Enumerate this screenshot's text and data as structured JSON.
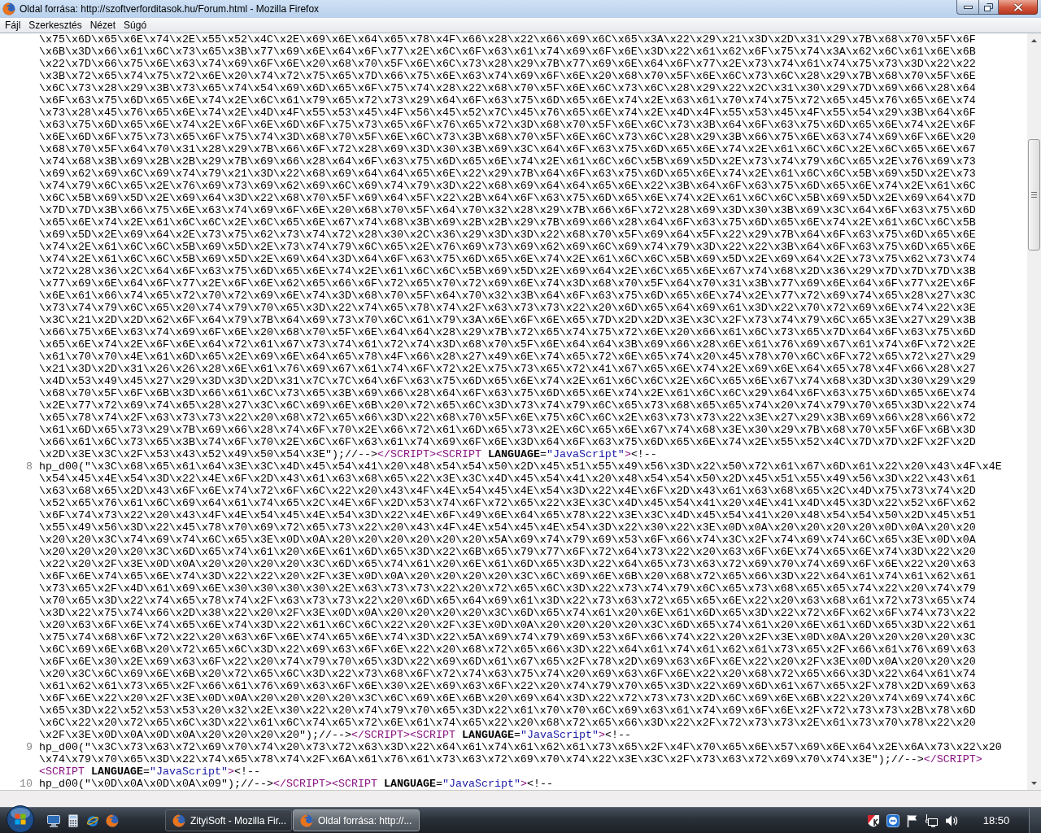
{
  "window": {
    "title": "Oldal forrása: http://szoftverforditasok.hu/Forum.html - Mozilla Firefox"
  },
  "menu": [
    "Fájl",
    "Szerkesztés",
    "Nézet",
    "Súgó"
  ],
  "source_view": {
    "lines": [
      {
        "rows": [
          [
            {
              "kind": "text",
              "text": "\\x75\\x6D\\x65\\x6E\\x74\\x2E\\x55\\x52\\x4C\\x2E\\x69\\x6E\\x64\\x65\\x78\\x4F\\x66\\x28\\x22\\x66\\x69\\x6C\\x65\\x3A\\x22\\x29\\x21\\x3D\\x2D\\x31\\x29\\x7B\\x68\\x70\\x5F\\x6F"
            }
          ],
          [
            {
              "kind": "text",
              "text": "\\x6B\\x3D\\x66\\x61\\x6C\\x73\\x65\\x3B\\x77\\x69\\x6E\\x64\\x6F\\x77\\x2E\\x6C\\x6F\\x63\\x61\\x74\\x69\\x6F\\x6E\\x3D\\x22\\x61\\x62\\x6F\\x75\\x74\\x3A\\x62\\x6C\\x61\\x6E\\x6B"
            }
          ],
          [
            {
              "kind": "text",
              "text": "\\x22\\x7D\\x66\\x75\\x6E\\x63\\x74\\x69\\x6F\\x6E\\x20\\x68\\x70\\x5F\\x6E\\x6C\\x73\\x28\\x29\\x7B\\x77\\x69\\x6E\\x64\\x6F\\x77\\x2E\\x73\\x74\\x61\\x74\\x75\\x73\\x3D\\x22\\x22"
            }
          ],
          [
            {
              "kind": "text",
              "text": "\\x3B\\x72\\x65\\x74\\x75\\x72\\x6E\\x20\\x74\\x72\\x75\\x65\\x7D\\x66\\x75\\x6E\\x63\\x74\\x69\\x6F\\x6E\\x20\\x68\\x70\\x5F\\x6E\\x6C\\x73\\x6C\\x28\\x29\\x7B\\x68\\x70\\x5F\\x6E"
            }
          ],
          [
            {
              "kind": "text",
              "text": "\\x6C\\x73\\x28\\x29\\x3B\\x73\\x65\\x74\\x54\\x69\\x6D\\x65\\x6F\\x75\\x74\\x28\\x22\\x68\\x70\\x5F\\x6E\\x6C\\x73\\x6C\\x28\\x29\\x22\\x2C\\x31\\x30\\x29\\x7D\\x69\\x66\\x28\\x64"
            }
          ],
          [
            {
              "kind": "text",
              "text": "\\x6F\\x63\\x75\\x6D\\x65\\x6E\\x74\\x2E\\x6C\\x61\\x79\\x65\\x72\\x73\\x29\\x64\\x6F\\x63\\x75\\x6D\\x65\\x6E\\x74\\x2E\\x63\\x61\\x70\\x74\\x75\\x72\\x65\\x45\\x76\\x65\\x6E\\x74"
            }
          ],
          [
            {
              "kind": "text",
              "text": "\\x73\\x28\\x45\\x76\\x65\\x6E\\x74\\x2E\\x4D\\x4F\\x55\\x53\\x45\\x4F\\x56\\x45\\x52\\x7C\\x45\\x76\\x65\\x6E\\x74\\x2E\\x4D\\x4F\\x55\\x53\\x45\\x4F\\x55\\x54\\x29\\x3B\\x64\\x6F"
            }
          ],
          [
            {
              "kind": "text",
              "text": "\\x63\\x75\\x6D\\x65\\x6E\\x74\\x2E\\x6F\\x6E\\x6D\\x6F\\x75\\x73\\x65\\x6F\\x76\\x65\\x72\\x3D\\x68\\x70\\x5F\\x6E\\x6C\\x73\\x3B\\x64\\x6F\\x63\\x75\\x6D\\x65\\x6E\\x74\\x2E\\x6F"
            }
          ],
          [
            {
              "kind": "text",
              "text": "\\x6E\\x6D\\x6F\\x75\\x73\\x65\\x6F\\x75\\x74\\x3D\\x68\\x70\\x5F\\x6E\\x6C\\x73\\x3B\\x68\\x70\\x5F\\x6E\\x6C\\x73\\x6C\\x28\\x29\\x3B\\x66\\x75\\x6E\\x63\\x74\\x69\\x6F\\x6E\\x20"
            }
          ],
          [
            {
              "kind": "text",
              "text": "\\x68\\x70\\x5F\\x64\\x70\\x31\\x28\\x29\\x7B\\x66\\x6F\\x72\\x28\\x69\\x3D\\x30\\x3B\\x69\\x3C\\x64\\x6F\\x63\\x75\\x6D\\x65\\x6E\\x74\\x2E\\x61\\x6C\\x6C\\x2E\\x6C\\x65\\x6E\\x67"
            }
          ],
          [
            {
              "kind": "text",
              "text": "\\x74\\x68\\x3B\\x69\\x2B\\x2B\\x29\\x7B\\x69\\x66\\x28\\x64\\x6F\\x63\\x75\\x6D\\x65\\x6E\\x74\\x2E\\x61\\x6C\\x6C\\x5B\\x69\\x5D\\x2E\\x73\\x74\\x79\\x6C\\x65\\x2E\\x76\\x69\\x73"
            }
          ],
          [
            {
              "kind": "text",
              "text": "\\x69\\x62\\x69\\x6C\\x69\\x74\\x79\\x21\\x3D\\x22\\x68\\x69\\x64\\x64\\x65\\x6E\\x22\\x29\\x7B\\x64\\x6F\\x63\\x75\\x6D\\x65\\x6E\\x74\\x2E\\x61\\x6C\\x6C\\x5B\\x69\\x5D\\x2E\\x73"
            }
          ],
          [
            {
              "kind": "text",
              "text": "\\x74\\x79\\x6C\\x65\\x2E\\x76\\x69\\x73\\x69\\x62\\x69\\x6C\\x69\\x74\\x79\\x3D\\x22\\x68\\x69\\x64\\x64\\x65\\x6E\\x22\\x3B\\x64\\x6F\\x63\\x75\\x6D\\x65\\x6E\\x74\\x2E\\x61\\x6C"
            }
          ],
          [
            {
              "kind": "text",
              "text": "\\x6C\\x5B\\x69\\x5D\\x2E\\x69\\x64\\x3D\\x22\\x68\\x70\\x5F\\x69\\x64\\x5F\\x22\\x2B\\x64\\x6F\\x63\\x75\\x6D\\x65\\x6E\\x74\\x2E\\x61\\x6C\\x6C\\x5B\\x69\\x5D\\x2E\\x69\\x64\\x7D"
            }
          ],
          [
            {
              "kind": "text",
              "text": "\\x7D\\x7D\\x3B\\x66\\x75\\x6E\\x63\\x74\\x69\\x6F\\x6E\\x20\\x68\\x70\\x5F\\x64\\x70\\x32\\x28\\x29\\x7B\\x66\\x6F\\x72\\x28\\x69\\x3D\\x30\\x3B\\x69\\x3C\\x64\\x6F\\x63\\x75\\x6D"
            }
          ],
          [
            {
              "kind": "text",
              "text": "\\x65\\x6E\\x74\\x2E\\x61\\x6C\\x6C\\x2E\\x6C\\x65\\x6E\\x67\\x74\\x68\\x3B\\x69\\x2B\\x2B\\x29\\x7B\\x69\\x66\\x28\\x64\\x6F\\x63\\x75\\x6D\\x65\\x6E\\x74\\x2E\\x61\\x6C\\x6C\\x5B"
            }
          ],
          [
            {
              "kind": "text",
              "text": "\\x69\\x5D\\x2E\\x69\\x64\\x2E\\x73\\x75\\x62\\x73\\x74\\x72\\x28\\x30\\x2C\\x36\\x29\\x3D\\x3D\\x22\\x68\\x70\\x5F\\x69\\x64\\x5F\\x22\\x29\\x7B\\x64\\x6F\\x63\\x75\\x6D\\x65\\x6E"
            }
          ],
          [
            {
              "kind": "text",
              "text": "\\x74\\x2E\\x61\\x6C\\x6C\\x5B\\x69\\x5D\\x2E\\x73\\x74\\x79\\x6C\\x65\\x2E\\x76\\x69\\x73\\x69\\x62\\x69\\x6C\\x69\\x74\\x79\\x3D\\x22\\x22\\x3B\\x64\\x6F\\x63\\x75\\x6D\\x65\\x6E"
            }
          ],
          [
            {
              "kind": "text",
              "text": "\\x74\\x2E\\x61\\x6C\\x6C\\x5B\\x69\\x5D\\x2E\\x69\\x64\\x3D\\x64\\x6F\\x63\\x75\\x6D\\x65\\x6E\\x74\\x2E\\x61\\x6C\\x6C\\x5B\\x69\\x5D\\x2E\\x69\\x64\\x2E\\x73\\x75\\x62\\x73\\x74"
            }
          ],
          [
            {
              "kind": "text",
              "text": "\\x72\\x28\\x36\\x2C\\x64\\x6F\\x63\\x75\\x6D\\x65\\x6E\\x74\\x2E\\x61\\x6C\\x6C\\x5B\\x69\\x5D\\x2E\\x69\\x64\\x2E\\x6C\\x65\\x6E\\x67\\x74\\x68\\x2D\\x36\\x29\\x7D\\x7D\\x7D\\x3B"
            }
          ],
          [
            {
              "kind": "text",
              "text": "\\x77\\x69\\x6E\\x64\\x6F\\x77\\x2E\\x6F\\x6E\\x62\\x65\\x66\\x6F\\x72\\x65\\x70\\x72\\x69\\x6E\\x74\\x3D\\x68\\x70\\x5F\\x64\\x70\\x31\\x3B\\x77\\x69\\x6E\\x64\\x6F\\x77\\x2E\\x6F"
            }
          ],
          [
            {
              "kind": "text",
              "text": "\\x6E\\x61\\x66\\x74\\x65\\x72\\x70\\x72\\x69\\x6E\\x74\\x3D\\x68\\x70\\x5F\\x64\\x70\\x32\\x3B\\x64\\x6F\\x63\\x75\\x6D\\x65\\x6E\\x74\\x2E\\x77\\x72\\x69\\x74\\x65\\x28\\x27\\x3C"
            }
          ],
          [
            {
              "kind": "text",
              "text": "\\x73\\x74\\x79\\x6C\\x65\\x20\\x74\\x79\\x70\\x65\\x3D\\x22\\x74\\x65\\x78\\x74\\x2F\\x63\\x73\\x73\\x22\\x20\\x6D\\x65\\x64\\x69\\x61\\x3D\\x22\\x70\\x72\\x69\\x6E\\x74\\x22\\x3E"
            }
          ],
          [
            {
              "kind": "text",
              "text": "\\x3C\\x21\\x2D\\x2D\\x62\\x6F\\x64\\x79\\x7B\\x64\\x69\\x73\\x70\\x6C\\x61\\x79\\x3A\\x6E\\x6F\\x6E\\x65\\x7D\\x2D\\x2D\\x3E\\x3C\\x2F\\x73\\x74\\x79\\x6C\\x65\\x3E\\x27\\x29\\x3B"
            }
          ],
          [
            {
              "kind": "text",
              "text": "\\x66\\x75\\x6E\\x63\\x74\\x69\\x6F\\x6E\\x20\\x68\\x70\\x5F\\x6E\\x64\\x64\\x28\\x29\\x7B\\x72\\x65\\x74\\x75\\x72\\x6E\\x20\\x66\\x61\\x6C\\x73\\x65\\x7D\\x64\\x6F\\x63\\x75\\x6D"
            }
          ],
          [
            {
              "kind": "text",
              "text": "\\x65\\x6E\\x74\\x2E\\x6F\\x6E\\x64\\x72\\x61\\x67\\x73\\x74\\x61\\x72\\x74\\x3D\\x68\\x70\\x5F\\x6E\\x64\\x64\\x3B\\x69\\x66\\x28\\x6E\\x61\\x76\\x69\\x67\\x61\\x74\\x6F\\x72\\x2E"
            }
          ],
          [
            {
              "kind": "text",
              "text": "\\x61\\x70\\x70\\x4E\\x61\\x6D\\x65\\x2E\\x69\\x6E\\x64\\x65\\x78\\x4F\\x66\\x28\\x27\\x49\\x6E\\x74\\x65\\x72\\x6E\\x65\\x74\\x20\\x45\\x78\\x70\\x6C\\x6F\\x72\\x65\\x72\\x27\\x29"
            }
          ],
          [
            {
              "kind": "text",
              "text": "\\x21\\x3D\\x2D\\x31\\x26\\x26\\x28\\x6E\\x61\\x76\\x69\\x67\\x61\\x74\\x6F\\x72\\x2E\\x75\\x73\\x65\\x72\\x41\\x67\\x65\\x6E\\x74\\x2E\\x69\\x6E\\x64\\x65\\x78\\x4F\\x66\\x28\\x27"
            }
          ],
          [
            {
              "kind": "text",
              "text": "\\x4D\\x53\\x49\\x45\\x27\\x29\\x3D\\x3D\\x2D\\x31\\x7C\\x7C\\x64\\x6F\\x63\\x75\\x6D\\x65\\x6E\\x74\\x2E\\x61\\x6C\\x6C\\x2E\\x6C\\x65\\x6E\\x67\\x74\\x68\\x3D\\x3D\\x30\\x29\\x29"
            }
          ],
          [
            {
              "kind": "text",
              "text": "\\x68\\x70\\x5F\\x6F\\x6B\\x3D\\x66\\x61\\x6C\\x73\\x65\\x3B\\x69\\x66\\x28\\x64\\x6F\\x63\\x75\\x6D\\x65\\x6E\\x74\\x2E\\x61\\x6C\\x6C\\x29\\x64\\x6F\\x63\\x75\\x6D\\x65\\x6E\\x74"
            }
          ],
          [
            {
              "kind": "text",
              "text": "\\x2E\\x77\\x72\\x69\\x74\\x65\\x28\\x27\\x3C\\x6C\\x69\\x6E\\x6B\\x20\\x72\\x65\\x6C\\x3D\\x73\\x74\\x79\\x6C\\x65\\x73\\x68\\x65\\x65\\x74\\x20\\x74\\x79\\x70\\x65\\x3D\\x22\\x74"
            }
          ],
          [
            {
              "kind": "text",
              "text": "\\x65\\x78\\x74\\x2F\\x63\\x73\\x73\\x22\\x20\\x68\\x72\\x65\\x66\\x3D\\x22\\x68\\x70\\x5F\\x6E\\x75\\x6C\\x6C\\x2E\\x63\\x73\\x73\\x22\\x3E\\x27\\x29\\x3B\\x69\\x66\\x28\\x66\\x72"
            }
          ],
          [
            {
              "kind": "text",
              "text": "\\x61\\x6D\\x65\\x73\\x29\\x7B\\x69\\x66\\x28\\x74\\x6F\\x70\\x2E\\x66\\x72\\x61\\x6D\\x65\\x73\\x2E\\x6C\\x65\\x6E\\x67\\x74\\x68\\x3E\\x30\\x29\\x7B\\x68\\x70\\x5F\\x6F\\x6B\\x3D"
            }
          ],
          [
            {
              "kind": "text",
              "text": "\\x66\\x61\\x6C\\x73\\x65\\x3B\\x74\\x6F\\x70\\x2E\\x6C\\x6F\\x63\\x61\\x74\\x69\\x6F\\x6E\\x3D\\x64\\x6F\\x63\\x75\\x6D\\x65\\x6E\\x74\\x2E\\x55\\x52\\x4C\\x7D\\x7D\\x2F\\x2F\\x2D"
            }
          ],
          [
            {
              "kind": "text",
              "text": "\\x2D\\x3E\\x3C\\x2F\\x53\\x43\\x52\\x49\\x50\\x54\\x3E\");//-->"
            },
            {
              "kind": "tag",
              "text": "</SCRIPT><SCRIPT"
            },
            {
              "kind": "text",
              "text": " "
            },
            {
              "kind": "attr",
              "text": "LANGUAGE"
            },
            {
              "kind": "text",
              "text": "="
            },
            {
              "kind": "value",
              "text": "\"JavaScript\""
            },
            {
              "kind": "tag",
              "text": ">"
            },
            {
              "kind": "text",
              "text": "<!--"
            }
          ]
        ]
      },
      {
        "number": "8",
        "rows": [
          [
            {
              "kind": "text",
              "text": "hp_d00(\"\\x3C\\x68\\x65\\x61\\x64\\x3E\\x3C\\x4D\\x45\\x54\\x41\\x20\\x48\\x54\\x54\\x50\\x2D\\x45\\x51\\x55\\x49\\x56\\x3D\\x22\\x50\\x72\\x61\\x67\\x6D\\x61\\x22\\x20\\x43\\x4F\\x4E"
            }
          ],
          [
            {
              "kind": "text",
              "text": "\\x54\\x45\\x4E\\x54\\x3D\\x22\\x4E\\x6F\\x2D\\x43\\x61\\x63\\x68\\x65\\x22\\x3E\\x3C\\x4D\\x45\\x54\\x41\\x20\\x48\\x54\\x54\\x50\\x2D\\x45\\x51\\x55\\x49\\x56\\x3D\\x22\\x43\\x61"
            }
          ],
          [
            {
              "kind": "text",
              "text": "\\x63\\x68\\x65\\x2D\\x43\\x6F\\x6E\\x74\\x72\\x6F\\x6C\\x22\\x20\\x43\\x4F\\x4E\\x54\\x45\\x4E\\x54\\x3D\\x22\\x4E\\x6F\\x2D\\x43\\x61\\x63\\x68\\x65\\x2C\\x4D\\x75\\x73\\x74\\x2D"
            }
          ],
          [
            {
              "kind": "text",
              "text": "\\x52\\x65\\x76\\x61\\x6C\\x69\\x64\\x61\\x74\\x65\\x2C\\x4E\\x6F\\x2D\\x53\\x74\\x6F\\x72\\x65\\x22\\x3E\\x3C\\x4D\\x45\\x54\\x41\\x20\\x4E\\x41\\x4D\\x45\\x3D\\x22\\x52\\x6F\\x62"
            }
          ],
          [
            {
              "kind": "text",
              "text": "\\x6F\\x74\\x73\\x22\\x20\\x43\\x4F\\x4E\\x54\\x45\\x4E\\x54\\x3D\\x22\\x4E\\x6F\\x49\\x6E\\x64\\x65\\x78\\x22\\x3E\\x3C\\x4D\\x45\\x54\\x41\\x20\\x48\\x54\\x54\\x50\\x2D\\x45\\x51"
            }
          ],
          [
            {
              "kind": "text",
              "text": "\\x55\\x49\\x56\\x3D\\x22\\x45\\x78\\x70\\x69\\x72\\x65\\x73\\x22\\x20\\x43\\x4F\\x4E\\x54\\x45\\x4E\\x54\\x3D\\x22\\x30\\x22\\x3E\\x0D\\x0A\\x20\\x20\\x20\\x20\\x0D\\x0A\\x20\\x20"
            }
          ],
          [
            {
              "kind": "text",
              "text": "\\x20\\x20\\x3C\\x74\\x69\\x74\\x6C\\x65\\x3E\\x0D\\x0A\\x20\\x20\\x20\\x20\\x20\\x20\\x5A\\x69\\x74\\x79\\x69\\x53\\x6F\\x66\\x74\\x3C\\x2F\\x74\\x69\\x74\\x6C\\x65\\x3E\\x0D\\x0A"
            }
          ],
          [
            {
              "kind": "text",
              "text": "\\x20\\x20\\x20\\x20\\x3C\\x6D\\x65\\x74\\x61\\x20\\x6E\\x61\\x6D\\x65\\x3D\\x22\\x6B\\x65\\x79\\x77\\x6F\\x72\\x64\\x73\\x22\\x20\\x63\\x6F\\x6E\\x74\\x65\\x6E\\x74\\x3D\\x22\\x20"
            }
          ],
          [
            {
              "kind": "text",
              "text": "\\x22\\x20\\x2F\\x3E\\x0D\\x0A\\x20\\x20\\x20\\x20\\x3C\\x6D\\x65\\x74\\x61\\x20\\x6E\\x61\\x6D\\x65\\x3D\\x22\\x64\\x65\\x73\\x63\\x72\\x69\\x70\\x74\\x69\\x6F\\x6E\\x22\\x20\\x63"
            }
          ],
          [
            {
              "kind": "text",
              "text": "\\x6F\\x6E\\x74\\x65\\x6E\\x74\\x3D\\x22\\x22\\x20\\x2F\\x3E\\x0D\\x0A\\x20\\x20\\x20\\x20\\x3C\\x6C\\x69\\x6E\\x6B\\x20\\x68\\x72\\x65\\x66\\x3D\\x22\\x64\\x61\\x74\\x61\\x62\\x61"
            }
          ],
          [
            {
              "kind": "text",
              "text": "\\x73\\x65\\x2F\\x4D\\x61\\x69\\x6E\\x30\\x30\\x30\\x30\\x2E\\x63\\x73\\x73\\x22\\x20\\x72\\x65\\x6C\\x3D\\x22\\x73\\x74\\x79\\x6C\\x65\\x73\\x68\\x65\\x65\\x74\\x22\\x20\\x74\\x79"
            }
          ],
          [
            {
              "kind": "text",
              "text": "\\x70\\x65\\x3D\\x22\\x74\\x65\\x78\\x74\\x2F\\x63\\x73\\x73\\x22\\x20\\x6D\\x65\\x64\\x69\\x61\\x3D\\x22\\x73\\x63\\x72\\x65\\x65\\x6E\\x22\\x20\\x63\\x68\\x61\\x72\\x73\\x65\\x74"
            }
          ],
          [
            {
              "kind": "text",
              "text": "\\x3D\\x22\\x75\\x74\\x66\\x2D\\x38\\x22\\x20\\x2F\\x3E\\x0D\\x0A\\x20\\x20\\x20\\x20\\x3C\\x6D\\x65\\x74\\x61\\x20\\x6E\\x61\\x6D\\x65\\x3D\\x22\\x72\\x6F\\x62\\x6F\\x74\\x73\\x22"
            }
          ],
          [
            {
              "kind": "text",
              "text": "\\x20\\x63\\x6F\\x6E\\x74\\x65\\x6E\\x74\\x3D\\x22\\x61\\x6C\\x6C\\x22\\x20\\x2F\\x3E\\x0D\\x0A\\x20\\x20\\x20\\x20\\x3C\\x6D\\x65\\x74\\x61\\x20\\x6E\\x61\\x6D\\x65\\x3D\\x22\\x61"
            }
          ],
          [
            {
              "kind": "text",
              "text": "\\x75\\x74\\x68\\x6F\\x72\\x22\\x20\\x63\\x6F\\x6E\\x74\\x65\\x6E\\x74\\x3D\\x22\\x5A\\x69\\x74\\x79\\x69\\x53\\x6F\\x66\\x74\\x22\\x20\\x2F\\x3E\\x0D\\x0A\\x20\\x20\\x20\\x20\\x3C"
            }
          ],
          [
            {
              "kind": "text",
              "text": "\\x6C\\x69\\x6E\\x6B\\x20\\x72\\x65\\x6C\\x3D\\x22\\x69\\x63\\x6F\\x6E\\x22\\x20\\x68\\x72\\x65\\x66\\x3D\\x22\\x64\\x61\\x74\\x61\\x62\\x61\\x73\\x65\\x2F\\x66\\x61\\x76\\x69\\x63"
            }
          ],
          [
            {
              "kind": "text",
              "text": "\\x6F\\x6E\\x30\\x2E\\x69\\x63\\x6F\\x22\\x20\\x74\\x79\\x70\\x65\\x3D\\x22\\x69\\x6D\\x61\\x67\\x65\\x2F\\x78\\x2D\\x69\\x63\\x6F\\x6E\\x22\\x20\\x2F\\x3E\\x0D\\x0A\\x20\\x20\\x20"
            }
          ],
          [
            {
              "kind": "text",
              "text": "\\x20\\x3C\\x6C\\x69\\x6E\\x6B\\x20\\x72\\x65\\x6C\\x3D\\x22\\x73\\x68\\x6F\\x72\\x74\\x63\\x75\\x74\\x20\\x69\\x63\\x6F\\x6E\\x22\\x20\\x68\\x72\\x65\\x66\\x3D\\x22\\x64\\x61\\x74"
            }
          ],
          [
            {
              "kind": "text",
              "text": "\\x61\\x62\\x61\\x73\\x65\\x2F\\x66\\x61\\x76\\x69\\x63\\x6F\\x6E\\x30\\x2E\\x69\\x63\\x6F\\x22\\x20\\x74\\x79\\x70\\x65\\x3D\\x22\\x69\\x6D\\x61\\x67\\x65\\x2F\\x78\\x2D\\x69\\x63"
            }
          ],
          [
            {
              "kind": "text",
              "text": "\\x6F\\x6E\\x22\\x20\\x2F\\x3E\\x0D\\x0A\\x20\\x20\\x20\\x20\\x3C\\x6C\\x69\\x6E\\x6B\\x20\\x69\\x64\\x3D\\x22\\x72\\x73\\x73\\x2D\\x6C\\x69\\x6E\\x6B\\x22\\x20\\x74\\x69\\x74\\x6C"
            }
          ],
          [
            {
              "kind": "text",
              "text": "\\x65\\x3D\\x22\\x52\\x53\\x53\\x20\\x32\\x2E\\x30\\x22\\x20\\x74\\x79\\x70\\x65\\x3D\\x22\\x61\\x70\\x70\\x6C\\x69\\x63\\x61\\x74\\x69\\x6F\\x6E\\x2F\\x72\\x73\\x73\\x2B\\x78\\x6D"
            }
          ],
          [
            {
              "kind": "text",
              "text": "\\x6C\\x22\\x20\\x72\\x65\\x6C\\x3D\\x22\\x61\\x6C\\x74\\x65\\x72\\x6E\\x61\\x74\\x65\\x22\\x20\\x68\\x72\\x65\\x66\\x3D\\x22\\x2F\\x72\\x73\\x73\\x2E\\x61\\x73\\x70\\x78\\x22\\x20"
            }
          ],
          [
            {
              "kind": "text",
              "text": "\\x2F\\x3E\\x0D\\x0A\\x0D\\x0A\\x20\\x20\\x20\\x20\");//-->"
            },
            {
              "kind": "tag",
              "text": "</SCRIPT><SCRIPT"
            },
            {
              "kind": "text",
              "text": " "
            },
            {
              "kind": "attr",
              "text": "LANGUAGE"
            },
            {
              "kind": "text",
              "text": "="
            },
            {
              "kind": "value",
              "text": "\"JavaScript\""
            },
            {
              "kind": "tag",
              "text": ">"
            },
            {
              "kind": "text",
              "text": "<!--"
            }
          ]
        ]
      },
      {
        "number": "9",
        "rows": [
          [
            {
              "kind": "text",
              "text": "hp_d00(\"\\x3C\\x73\\x63\\x72\\x69\\x70\\x74\\x20\\x73\\x72\\x63\\x3D\\x22\\x64\\x61\\x74\\x61\\x62\\x61\\x73\\x65\\x2F\\x4F\\x70\\x65\\x6E\\x57\\x69\\x6E\\x64\\x2E\\x6A\\x73\\x22\\x20"
            }
          ],
          [
            {
              "kind": "text",
              "text": "\\x74\\x79\\x70\\x65\\x3D\\x22\\x74\\x65\\x78\\x74\\x2F\\x6A\\x61\\x76\\x61\\x73\\x63\\x72\\x69\\x70\\x74\\x22\\x3E\\x3C\\x2F\\x73\\x63\\x72\\x69\\x70\\x74\\x3E\");//-->"
            },
            {
              "kind": "tag",
              "text": "</SCRIPT>"
            }
          ],
          [
            {
              "kind": "tag",
              "text": "<SCRIPT"
            },
            {
              "kind": "text",
              "text": " "
            },
            {
              "kind": "attr",
              "text": "LANGUAGE"
            },
            {
              "kind": "text",
              "text": "="
            },
            {
              "kind": "value",
              "text": "\"JavaScript\""
            },
            {
              "kind": "tag",
              "text": ">"
            },
            {
              "kind": "text",
              "text": "<!--"
            }
          ]
        ]
      },
      {
        "number": "10",
        "rows": [
          [
            {
              "kind": "text",
              "text": "hp_d00(\"\\x0D\\x0A\\x0D\\x0A\\x09\");//-->"
            },
            {
              "kind": "tag",
              "text": "</SCRIPT><SCRIPT"
            },
            {
              "kind": "text",
              "text": " "
            },
            {
              "kind": "attr",
              "text": "LANGUAGE"
            },
            {
              "kind": "text",
              "text": "="
            },
            {
              "kind": "value",
              "text": "\"JavaScript\""
            },
            {
              "kind": "tag",
              "text": ">"
            },
            {
              "kind": "text",
              "text": "<!--"
            }
          ]
        ]
      }
    ]
  },
  "taskbar": {
    "tasks": [
      {
        "label": "ZityiSoft - Mozilla Fir...",
        "selected": false
      },
      {
        "label": "Oldal forrása: http://...",
        "selected": true
      }
    ],
    "clock": "18:50"
  }
}
